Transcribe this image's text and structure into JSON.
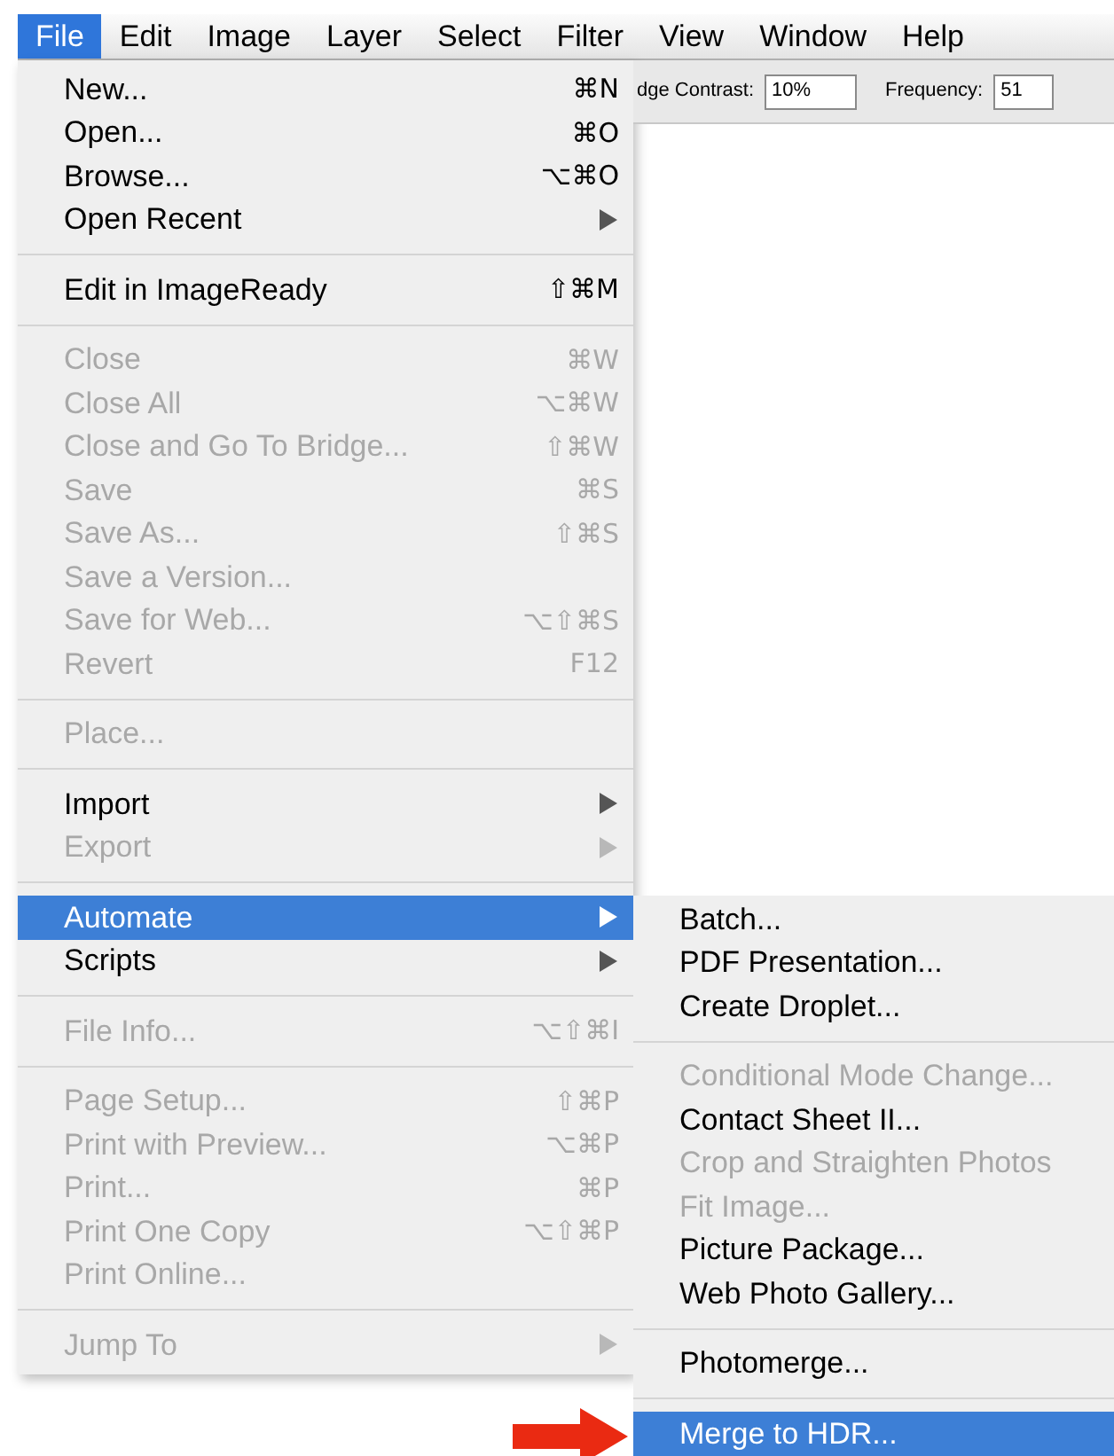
{
  "menu_bar": [
    {
      "label": "File",
      "selected": true
    },
    {
      "label": "Edit",
      "selected": false
    },
    {
      "label": "Image",
      "selected": false
    },
    {
      "label": "Layer",
      "selected": false
    },
    {
      "label": "Select",
      "selected": false
    },
    {
      "label": "Filter",
      "selected": false
    },
    {
      "label": "View",
      "selected": false
    },
    {
      "label": "Window",
      "selected": false
    },
    {
      "label": "Help",
      "selected": false
    }
  ],
  "options_bar": {
    "edge_contrast_label": "dge Contrast:",
    "edge_contrast_value": "10%",
    "frequency_label": "Frequency:",
    "frequency_value": "51"
  },
  "file_menu": [
    [
      {
        "label": "New...",
        "shortcut": "⌘N",
        "disabled": false,
        "submenu": false,
        "selected": false
      },
      {
        "label": "Open...",
        "shortcut": "⌘O",
        "disabled": false,
        "submenu": false,
        "selected": false
      },
      {
        "label": "Browse...",
        "shortcut": "⌥⌘O",
        "disabled": false,
        "submenu": false,
        "selected": false
      },
      {
        "label": "Open Recent",
        "disabled": false,
        "submenu": true,
        "selected": false
      }
    ],
    [
      {
        "label": "Edit in ImageReady",
        "shortcut": "⇧⌘M",
        "disabled": false,
        "submenu": false,
        "selected": false
      }
    ],
    [
      {
        "label": "Close",
        "shortcut": "⌘W",
        "disabled": true,
        "submenu": false,
        "selected": false
      },
      {
        "label": "Close All",
        "shortcut": "⌥⌘W",
        "disabled": true,
        "submenu": false,
        "selected": false
      },
      {
        "label": "Close and Go To Bridge...",
        "shortcut": "⇧⌘W",
        "disabled": true,
        "submenu": false,
        "selected": false
      },
      {
        "label": "Save",
        "shortcut": "⌘S",
        "disabled": true,
        "submenu": false,
        "selected": false
      },
      {
        "label": "Save As...",
        "shortcut": "⇧⌘S",
        "disabled": true,
        "submenu": false,
        "selected": false
      },
      {
        "label": "Save a Version...",
        "disabled": true,
        "submenu": false,
        "selected": false
      },
      {
        "label": "Save for Web...",
        "shortcut": "⌥⇧⌘S",
        "disabled": true,
        "submenu": false,
        "selected": false
      },
      {
        "label": "Revert",
        "shortcut": "F12",
        "disabled": true,
        "submenu": false,
        "selected": false
      }
    ],
    [
      {
        "label": "Place...",
        "disabled": true,
        "submenu": false,
        "selected": false
      }
    ],
    [
      {
        "label": "Import",
        "disabled": false,
        "submenu": true,
        "selected": false
      },
      {
        "label": "Export",
        "disabled": true,
        "submenu": true,
        "selected": false
      }
    ],
    [
      {
        "label": "Automate",
        "disabled": false,
        "submenu": true,
        "selected": true
      },
      {
        "label": "Scripts",
        "disabled": false,
        "submenu": true,
        "selected": false
      }
    ],
    [
      {
        "label": "File Info...",
        "shortcut": "⌥⇧⌘I",
        "disabled": true,
        "submenu": false,
        "selected": false
      }
    ],
    [
      {
        "label": "Page Setup...",
        "shortcut": "⇧⌘P",
        "disabled": true,
        "submenu": false,
        "selected": false
      },
      {
        "label": "Print with Preview...",
        "shortcut": "⌥⌘P",
        "disabled": true,
        "submenu": false,
        "selected": false
      },
      {
        "label": "Print...",
        "shortcut": "⌘P",
        "disabled": true,
        "submenu": false,
        "selected": false
      },
      {
        "label": "Print One Copy",
        "shortcut": "⌥⇧⌘P",
        "disabled": true,
        "submenu": false,
        "selected": false
      },
      {
        "label": "Print Online...",
        "disabled": true,
        "submenu": false,
        "selected": false
      }
    ],
    [
      {
        "label": "Jump To",
        "disabled": true,
        "submenu": true,
        "selected": false
      }
    ]
  ],
  "automate_submenu": [
    [
      {
        "label": "Batch...",
        "disabled": false,
        "selected": false
      },
      {
        "label": "PDF Presentation...",
        "disabled": false,
        "selected": false
      },
      {
        "label": "Create Droplet...",
        "disabled": false,
        "selected": false
      }
    ],
    [
      {
        "label": "Conditional Mode Change...",
        "disabled": true,
        "selected": false
      },
      {
        "label": "Contact Sheet II...",
        "disabled": false,
        "selected": false
      },
      {
        "label": "Crop and Straighten Photos",
        "disabled": true,
        "selected": false
      },
      {
        "label": "Fit Image...",
        "disabled": true,
        "selected": false
      },
      {
        "label": "Picture Package...",
        "disabled": false,
        "selected": false
      },
      {
        "label": "Web Photo Gallery...",
        "disabled": false,
        "selected": false
      }
    ],
    [
      {
        "label": "Photomerge...",
        "disabled": false,
        "selected": false
      }
    ],
    [
      {
        "label": "Merge to HDR...",
        "disabled": false,
        "selected": true
      }
    ]
  ]
}
